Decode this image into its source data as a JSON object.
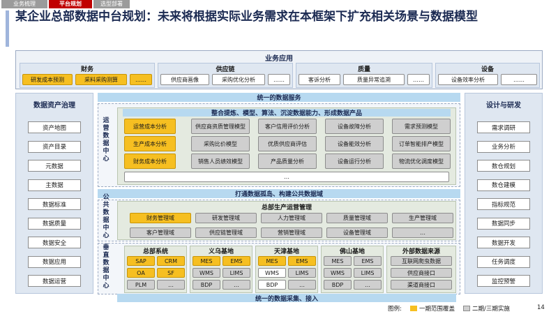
{
  "tabs": [
    "业务梳理",
    "平台规划",
    "选型部署"
  ],
  "title": "某企业总部数据中台规划：未来将根据实际业务需求在本框架下扩充相关场景与数据模型",
  "business_apps": {
    "header": "业务应用",
    "groups": [
      {
        "name": "财务",
        "items": [
          "研发成本预测",
          "采料采购测算",
          "……"
        ]
      },
      {
        "name": "供应链",
        "items": [
          "供应商画像",
          "采购优化分析",
          "……"
        ]
      },
      {
        "name": "质量",
        "items": [
          "客诉分析",
          "质量异常追溯",
          "……"
        ]
      },
      {
        "name": "设备",
        "items": [
          "设备效率分析",
          "……"
        ]
      }
    ]
  },
  "left_panel": {
    "title": "数据资产治理",
    "items": [
      "资产地图",
      "资产目录",
      "元数据",
      "主数据",
      "数据标准",
      "数据质量",
      "数据安全",
      "数据应用",
      "数据运营"
    ]
  },
  "right_panel": {
    "title": "设计与研发",
    "items": [
      "需求调研",
      "业务分析",
      "数仓规划",
      "数仓建模",
      "指标规范",
      "数据同步",
      "数据开发",
      "任务调度",
      "监控预警"
    ]
  },
  "ops_center": {
    "band": "统一的数据服务",
    "label": "运营数据中心",
    "subtitle": "整合提炼、模型、算法、沉淀数据能力、形成数据产品",
    "grid": [
      [
        "运营成本分析",
        "供应商资质管理模型",
        "客户信用评价分析",
        "设备故障分析",
        "需求预测模型"
      ],
      [
        "生产成本分析",
        "采购比价模型",
        "优质供应商评估",
        "设备能效分析",
        "订单智能排产模型"
      ],
      [
        "财务成本分析",
        "销售人员绩效模型",
        "产品质量分析",
        "设备运行分析",
        "物流优化调度模型"
      ]
    ],
    "more": "…"
  },
  "public_center": {
    "band": "打通数据孤岛、构建公共数据域",
    "label": "公共数据中心",
    "subtitle": "总部生产运营管理",
    "row1": [
      "财务管理域",
      "研发管理域",
      "人力管理域",
      "质量管理域",
      "生产管理域"
    ],
    "row2": [
      "客户管理域",
      "供应链管理域",
      "营销管理域",
      "设备管理域",
      "…"
    ]
  },
  "vertical_center": {
    "label": "垂直数据中心",
    "bottom_band": "统一的数据采集、接入",
    "groups": [
      {
        "name": "总部系统",
        "items": [
          "SAP",
          "CRM",
          "OA",
          "SF",
          "PLM",
          "…"
        ]
      },
      {
        "name": "义乌基地",
        "items": [
          "MES",
          "EMS",
          "WMS",
          "LIMS",
          "BDP",
          "…"
        ]
      },
      {
        "name": "天津基地",
        "items": [
          "MES",
          "EMS",
          "WMS",
          "LIMS",
          "BDP",
          "…"
        ]
      },
      {
        "name": "佛山基地",
        "items": [
          "MES",
          "EMS",
          "WMS",
          "LIMS",
          "BDP",
          "…"
        ]
      },
      {
        "name": "外部数据来源",
        "items": [
          "互联网爬虫数据",
          "供应商接口",
          "渠道商接口"
        ]
      }
    ]
  },
  "legend": {
    "label": "图例:",
    "phase1": "一期范围覆盖",
    "phase23": "二期/三期实施"
  },
  "page_number": "14",
  "colors": {
    "phase1": "#f6bf21",
    "phase23": "#cfcfcf",
    "band": "#b7d9f0",
    "panel": "#dfe7f1",
    "title": "#1b2a52"
  }
}
